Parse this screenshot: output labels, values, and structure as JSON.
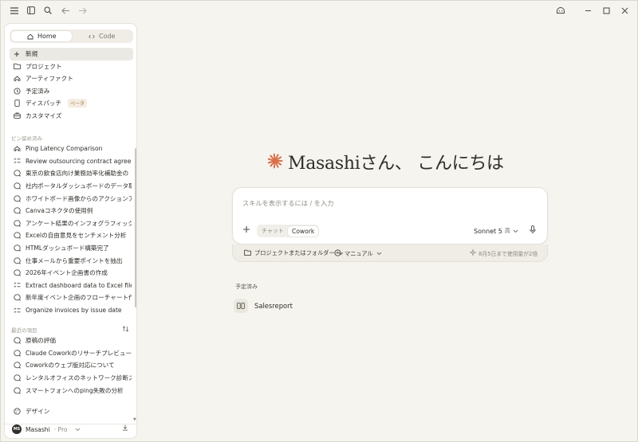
{
  "titlebar": {
    "icons": [
      "menu-icon",
      "sidebar-toggle-icon",
      "search-icon",
      "back-arrow-icon",
      "forward-arrow-icon",
      "assistant-face-icon",
      "minimize-icon",
      "maximize-icon",
      "close-icon"
    ]
  },
  "sidebar": {
    "mode_tabs": [
      {
        "label": "Home",
        "icon": "home-icon"
      },
      {
        "label": "Code",
        "icon": "code-icon"
      }
    ],
    "nav": [
      {
        "label": "新規",
        "icon": "plus-icon"
      },
      {
        "label": "プロジェクト",
        "icon": "folder-icon"
      },
      {
        "label": "アーティファクト",
        "icon": "artifact-icon"
      },
      {
        "label": "予定済み",
        "icon": "clock-icon"
      },
      {
        "label": "ディスパッチ",
        "icon": "phone-icon",
        "badge": "ベータ"
      },
      {
        "label": "カスタマイズ",
        "icon": "briefcase-icon"
      }
    ],
    "pinned_label": "ピン留め済み",
    "pinned": [
      {
        "label": "Ping Latency Comparison",
        "icon": "artifact-icon"
      },
      {
        "label": "Review outsourcing contract agreement",
        "icon": "task-icon"
      },
      {
        "label": "東京の飲食店向け業務効率化補助金の",
        "icon": "chat-icon"
      },
      {
        "label": "社内ポータルダッシュボードのデータ取得",
        "icon": "chat-icon"
      },
      {
        "label": "ホワイトボード画像からのアクションアイテム抽出",
        "icon": "chat-icon"
      },
      {
        "label": "Canvaコネクタの使用例",
        "icon": "chat-icon"
      },
      {
        "label": "アンケート結果のインフォグラフィック化",
        "icon": "chat-icon"
      },
      {
        "label": "Excelの自由意見をセンチメント分析",
        "icon": "chat-icon"
      },
      {
        "label": "HTMLダッシュボード構築完了",
        "icon": "chat-icon"
      },
      {
        "label": "仕事メールから重要ポイントを抽出",
        "icon": "chat-icon"
      },
      {
        "label": "2026年イベント企画書の作成",
        "icon": "chat-icon"
      },
      {
        "label": "Extract dashboard data to Excel file",
        "icon": "task-icon"
      },
      {
        "label": "新年度イベント企画のフローチャート作成",
        "icon": "chat-icon"
      },
      {
        "label": "Organize invoices by issue date",
        "icon": "task-icon"
      }
    ],
    "recent_label": "最近の項目",
    "recent": [
      {
        "label": "原稿の評価",
        "icon": "chat-icon"
      },
      {
        "label": "Claude Coworkのリサーチプレビュー開始",
        "icon": "chat-icon"
      },
      {
        "label": "Coworkのウェブ版対応について",
        "icon": "chat-icon"
      },
      {
        "label": "レンタルオフィスのネットワーク診断スクリプト",
        "icon": "chat-icon"
      },
      {
        "label": "スマートフォンへのping失敗の分析",
        "icon": "chat-icon"
      }
    ],
    "design_label": "デザイン",
    "user": {
      "initials": "MS",
      "name": "Masashi",
      "plan": "· Pro"
    }
  },
  "main": {
    "greeting": "Masashiさん、 こんにちは",
    "composer": {
      "placeholder": "スキルを表示するには / を入力",
      "modes": [
        "チャット",
        "Cowork"
      ],
      "active_mode": "Cowork",
      "model": "Sonnet 5",
      "model_level": "高",
      "footer_project": "プロジェクトまたはフォルダー",
      "footer_permission": "マニュアル",
      "footer_usage": "8月5日まで使用量が2倍"
    },
    "scheduled_label": "予定済み",
    "scheduled": [
      {
        "name": "Salesreport",
        "icon": "schedule-icon"
      }
    ]
  },
  "colors": {
    "background": "#f5f4ef",
    "sidebar": "#ffffff",
    "accent_star": "#d9704b",
    "text": "#2f2e2a"
  }
}
